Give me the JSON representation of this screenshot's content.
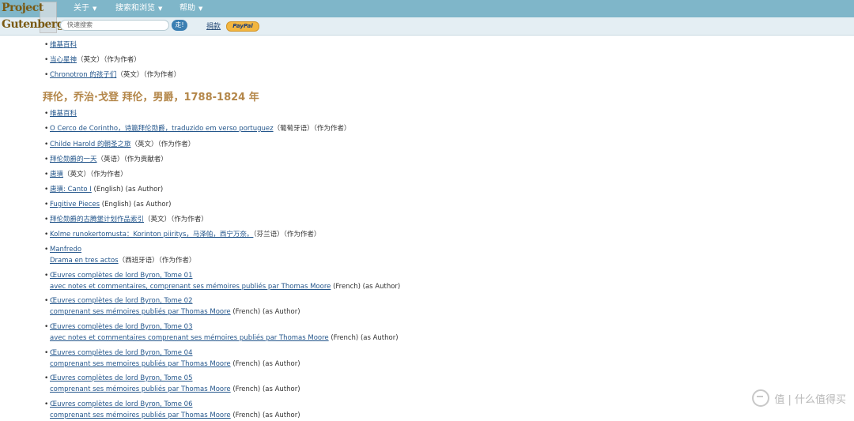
{
  "header": {
    "logo_line1": "Project",
    "logo_line2": "Gutenberg",
    "nav": [
      {
        "label": "关于"
      },
      {
        "label": "搜索和浏览"
      },
      {
        "label": "帮助"
      }
    ],
    "search_placeholder": "快速搜索",
    "go_label": "走!",
    "donate_label": "捐款",
    "paypal_label": "PayPal"
  },
  "top_items": [
    {
      "link": "维基百科",
      "meta": ""
    },
    {
      "link": "当心星神",
      "meta": "（英文）（作为作者）"
    },
    {
      "link": "Chronotron 的孩子们",
      "meta": "（英文）（作为作者）"
    }
  ],
  "section_heading": "拜伦，乔治·戈登 拜伦，男爵，1788-1824 年",
  "items": [
    {
      "link": "维基百科",
      "meta": ""
    },
    {
      "link": "O Cerco de Corintho，诗篇拜伦勋爵，traduzido em verso portuguez",
      "meta": "（葡萄牙语）（作为作者）"
    },
    {
      "link": "Childe Harold 的朝圣之旅",
      "meta": "（英文）（作为作者）"
    },
    {
      "link": "拜伦勋爵的一天",
      "meta": "（英语）（作为贡献者）"
    },
    {
      "link": "唐璜",
      "meta": "（英文）（作为作者）"
    },
    {
      "link": "唐璜: Canto I",
      "meta": "(English) (as Author)"
    },
    {
      "link": "Fugitive Pieces",
      "meta": "(English) (as Author)"
    },
    {
      "link": "拜伦勋爵的古腾堡计划作品索引",
      "meta": "（英文）（作为作者）"
    },
    {
      "link": "Kolme runokertomusta：Korinton piiritys，马泽帕，西宁万奈。",
      "meta": "（芬兰语）（作为作者）"
    },
    {
      "link": "Manfredo",
      "sublink": "Drama en tres actos",
      "meta": "（西班牙语）（作为作者）"
    },
    {
      "link": "Œuvres complètes de lord Byron, Tome 01",
      "sublink": "avec notes et commentaires, comprenant ses mémoires publiés par Thomas Moore",
      "meta": "(French) (as Author)"
    },
    {
      "link": "Œuvres complètes de lord Byron, Tome 02",
      "sublink": "comprenant ses mémoires publiés par Thomas Moore",
      "meta": "(French) (as Author)"
    },
    {
      "link": "Œuvres complètes de lord Byron, Tome 03",
      "sublink": "avec notes et commentaires comprenant ses mémoires publiés par Thomas Moore",
      "meta": "(French) (as Author)"
    },
    {
      "link": "Œuvres complètes de lord Byron, Tome 04",
      "sublink": "comprenant ses memoires publiés par Thomas Moore",
      "meta": "(French) (as Author)"
    },
    {
      "link": "Œuvres complètes de lord Byron, Tome 05",
      "sublink": "comprenant ses mémoires publiés par Thomas Moore",
      "meta": "(French) (as Author)"
    },
    {
      "link": "Œuvres complètes de lord Byron, Tome 06",
      "sublink": "comprenant ses mémoires publiés par Thomas Moore",
      "meta": "(French) (as Author)"
    }
  ],
  "watermark": "值 | 什么值得买"
}
